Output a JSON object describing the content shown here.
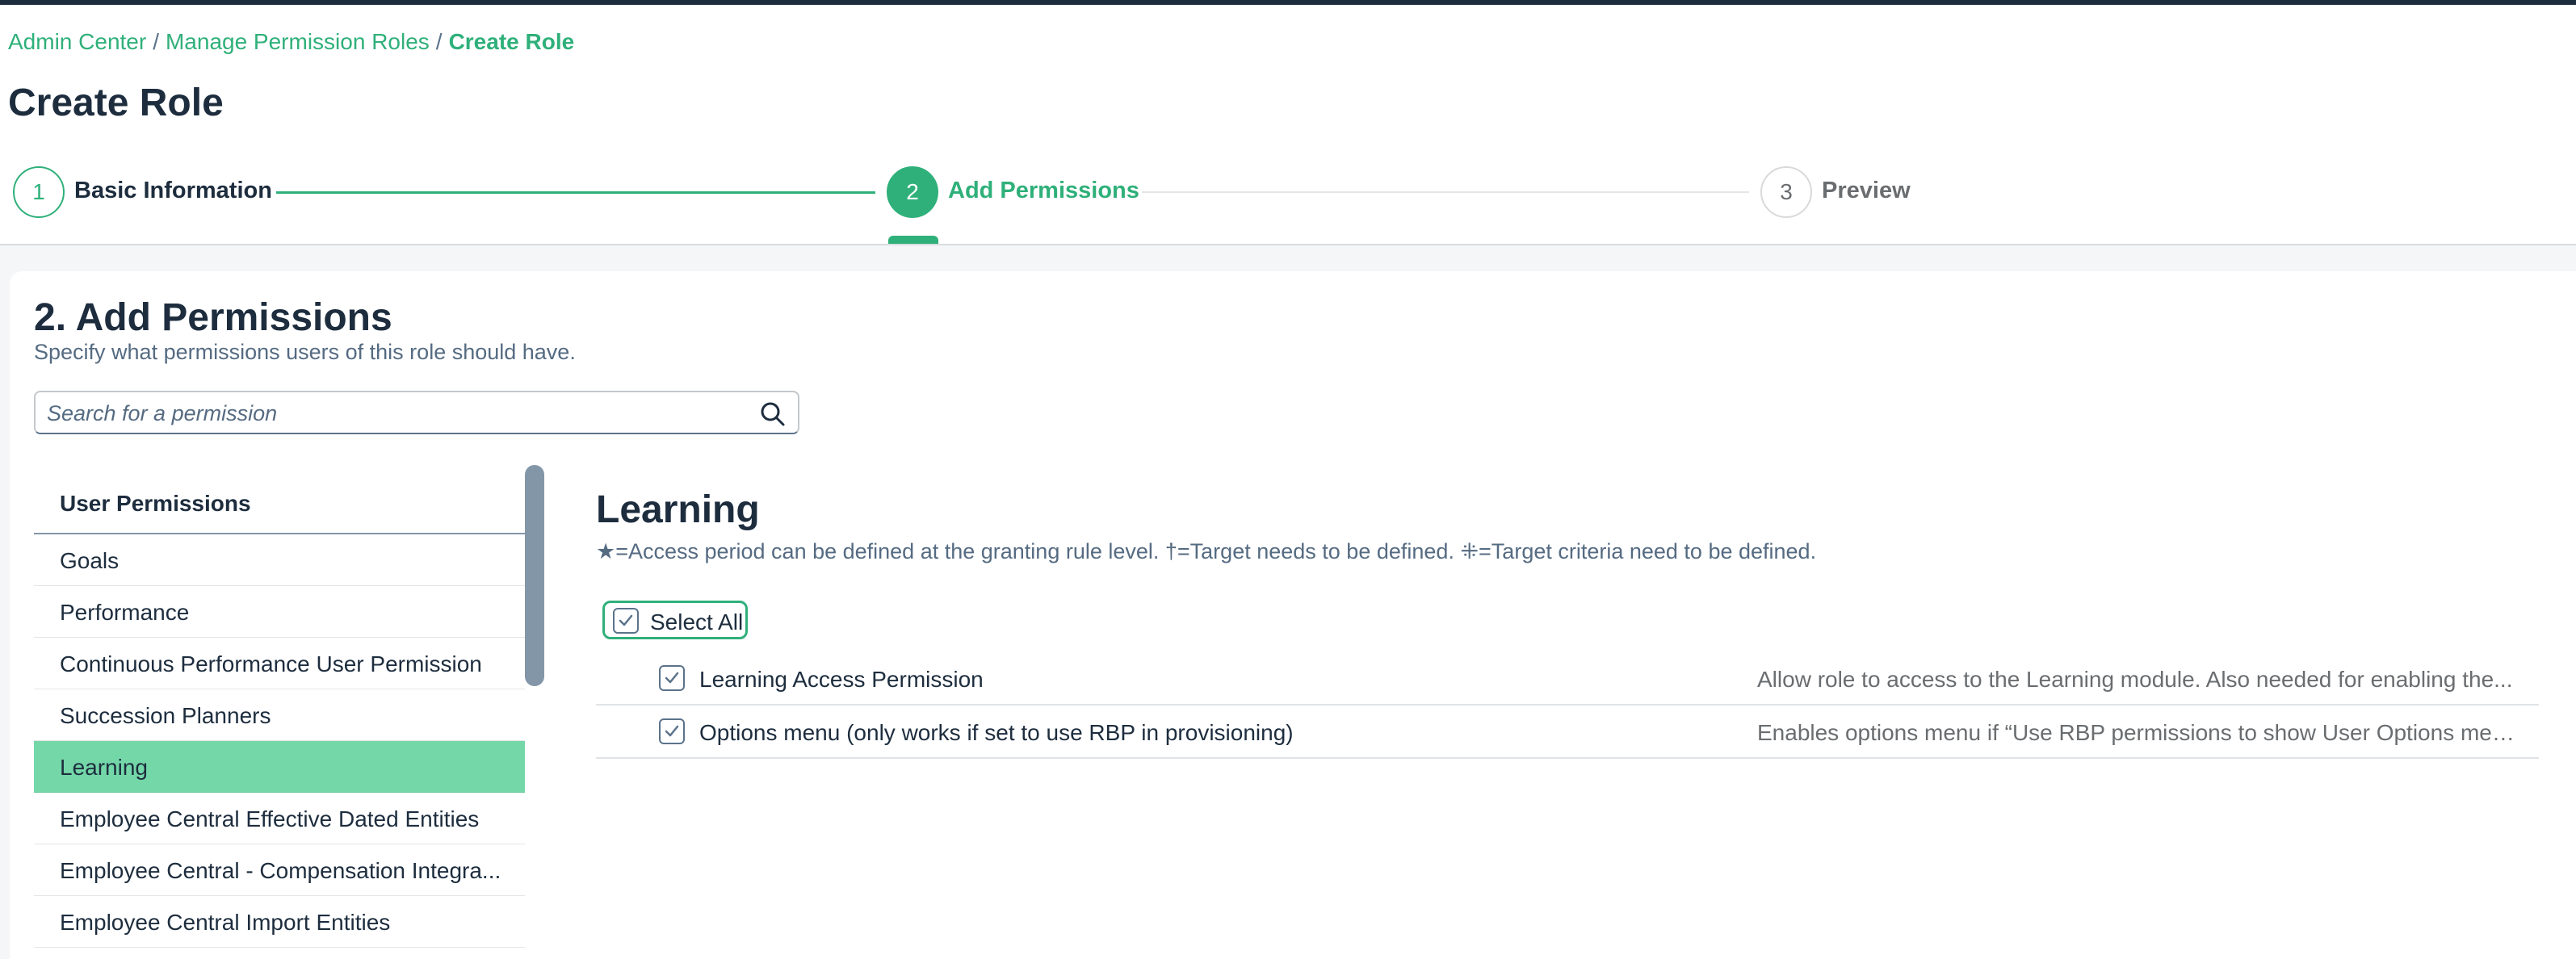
{
  "breadcrumb": {
    "items": [
      "Admin Center",
      "Manage Permission Roles"
    ],
    "current": "Create Role",
    "separator": "/"
  },
  "page_title": "Create Role",
  "wizard": {
    "steps": [
      {
        "number": "1",
        "label": "Basic Information",
        "state": "done"
      },
      {
        "number": "2",
        "label": "Add Permissions",
        "state": "active"
      },
      {
        "number": "3",
        "label": "Preview",
        "state": "todo"
      }
    ]
  },
  "section": {
    "title": "2. Add Permissions",
    "subtitle": "Specify what permissions users of this role should have."
  },
  "search": {
    "placeholder": "Search for a permission",
    "value": ""
  },
  "permission_list": {
    "header": "User Permissions",
    "items": [
      "Goals",
      "Performance",
      "Continuous Performance User Permission",
      "Succession Planners",
      "Learning",
      "Employee Central Effective Dated Entities",
      "Employee Central - Compensation Integra...",
      "Employee Central Import Entities"
    ],
    "selected": "Learning"
  },
  "category": {
    "title": "Learning",
    "legend": "★=Access period can be defined at the granting rule level.  †=Target needs to be defined.  ⁜=Target criteria need to be defined.",
    "select_all_label": "Select All",
    "select_all_checked": true,
    "permissions": [
      {
        "name": "Learning Access Permission",
        "description": "Allow role to access to the Learning module. Also needed for enabling the...",
        "checked": true
      },
      {
        "name": "Options menu (only works if set to use RBP in provisioning)",
        "description": "Enables options menu if “Use RBP permissions to show User Options men...",
        "checked": true
      }
    ]
  },
  "colors": {
    "accent": "#2fb07a",
    "selected_row": "#74d7a8",
    "text_primary": "#1d2d3e",
    "text_secondary": "#556b82"
  },
  "icons": {
    "search": "search-icon",
    "checkbox_check": "check-icon"
  }
}
